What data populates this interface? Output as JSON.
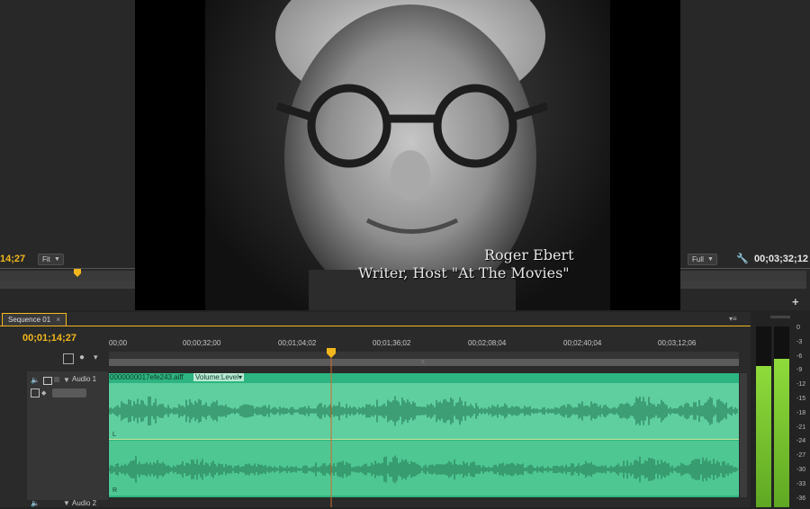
{
  "source_monitor": {
    "timecode": "14;27",
    "zoom_label": "Fit"
  },
  "program_monitor": {
    "timecode": "00;03;32;12",
    "resolution_label": "Full"
  },
  "video": {
    "caption_name": "Roger Ebert",
    "caption_title": "Writer, Host \"At The Movies\""
  },
  "timeline": {
    "tab_label": "Sequence 01",
    "current_timecode": "00;01;14;27",
    "ruler_labels": [
      "00;00",
      "00;00;32;00",
      "00;01;04;02",
      "00;01;36;02",
      "00;02;08;04",
      "00;02;40;04",
      "00;03;12;06"
    ],
    "tracks": [
      {
        "name": "Audio 1"
      },
      {
        "name": "Audio 2"
      }
    ],
    "clip": {
      "filename": "0000000017efe243.aiff",
      "effect_label": "Volume:Level",
      "channel_left": "L",
      "channel_right": "R"
    },
    "playhead_fraction": 0.353
  },
  "audio_meter": {
    "db_labels": [
      "0",
      "-3",
      "-6",
      "-9",
      "-12",
      "-15",
      "-18",
      "-21",
      "-24",
      "-27",
      "-30",
      "-33",
      "-36"
    ],
    "level_left_fraction": 0.78,
    "level_right_fraction": 0.82,
    "colors": {
      "meter": "#8fdb3b",
      "timecode": "#f1b71d",
      "clip": "#2db480"
    }
  }
}
